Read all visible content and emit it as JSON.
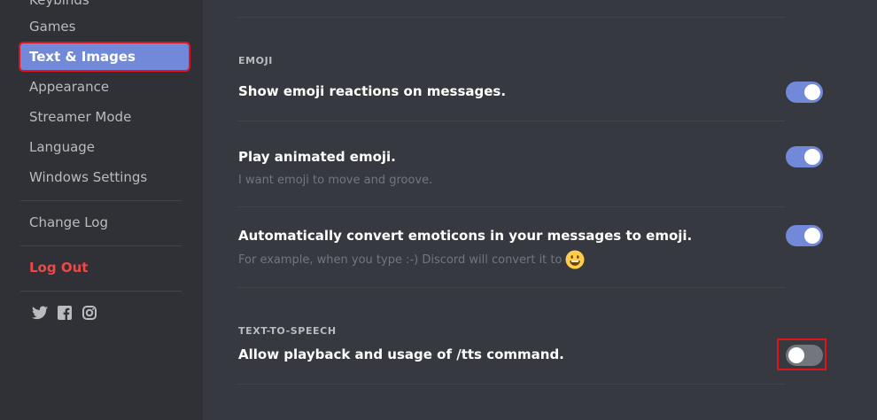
{
  "sidebar": {
    "partial_top_item": "Keybinds",
    "items": [
      {
        "label": "Games"
      },
      {
        "label": "Text & Images",
        "selected": true
      },
      {
        "label": "Appearance"
      },
      {
        "label": "Streamer Mode"
      },
      {
        "label": "Language"
      },
      {
        "label": "Windows Settings"
      },
      {
        "label": "Change Log"
      },
      {
        "label": "Log Out"
      }
    ],
    "social": [
      "twitter-icon",
      "facebook-icon",
      "instagram-icon"
    ]
  },
  "emoji_section": {
    "header": "EMOJI",
    "settings": [
      {
        "title": "Show emoji reactions on messages.",
        "note": "",
        "enabled": true
      },
      {
        "title": "Play animated emoji.",
        "note": "I want emoji to move and groove.",
        "enabled": true
      },
      {
        "title": "Automatically convert emoticons in your messages to emoji.",
        "note": "For example, when you type :-) Discord will convert it to",
        "enabled": true
      }
    ]
  },
  "tts_section": {
    "header": "TEXT-TO-SPEECH",
    "settings": [
      {
        "title": "Allow playback and usage of /tts command.",
        "enabled": false
      }
    ]
  },
  "colors": {
    "sidebar_bg": "#2f3136",
    "content_bg": "#36393f",
    "accent": "#7289da",
    "danger": "#f04747",
    "highlight": "#e0141e"
  }
}
